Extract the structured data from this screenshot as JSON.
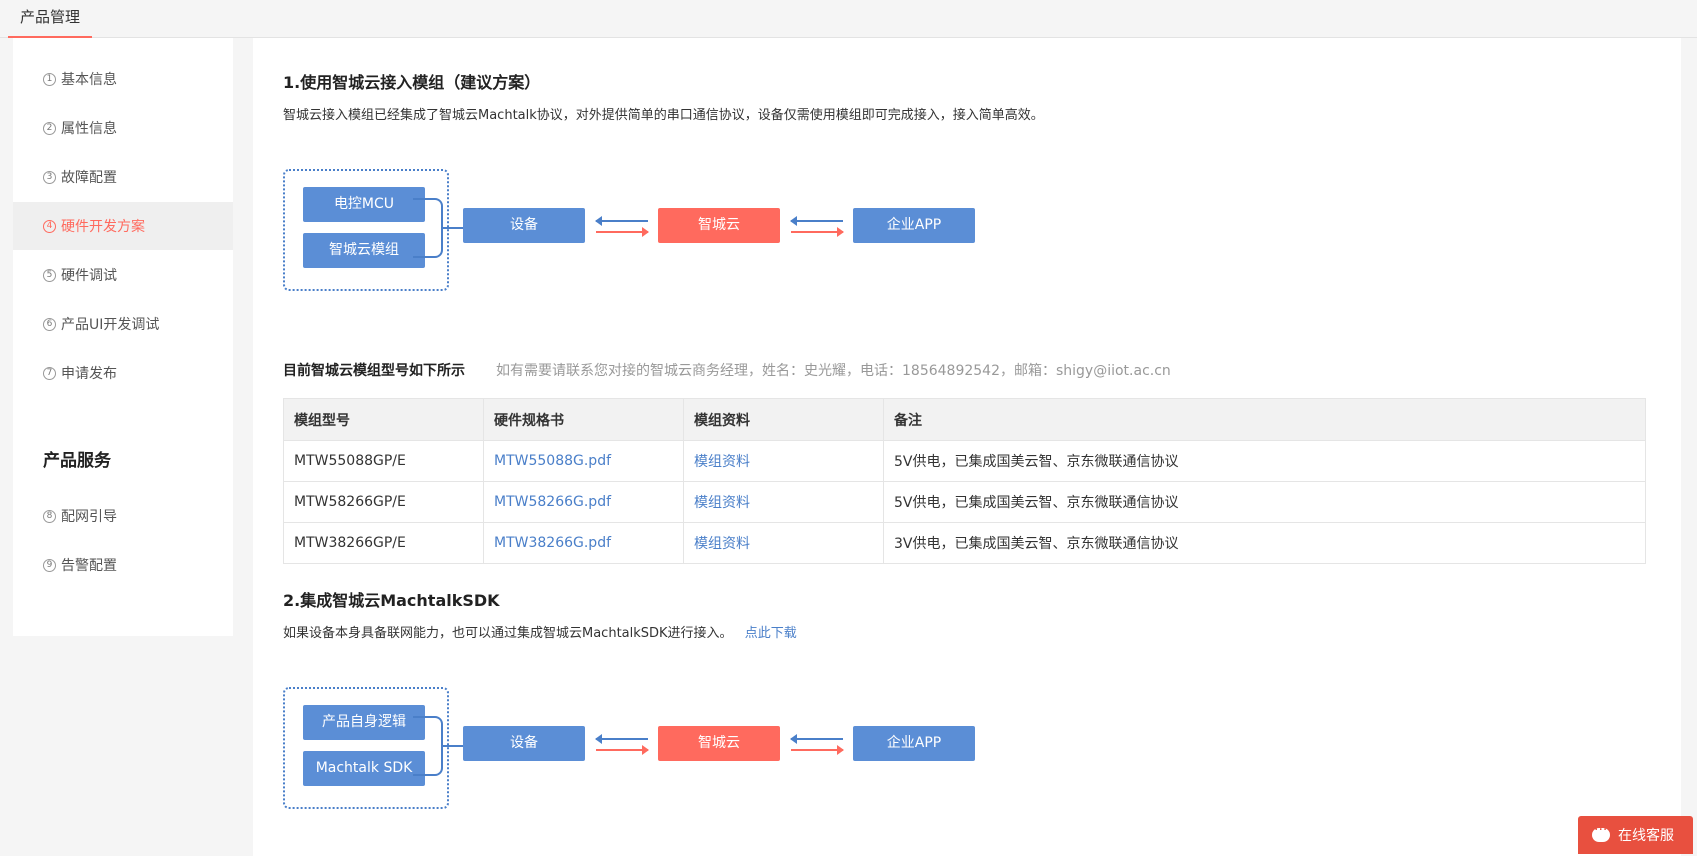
{
  "topbar": {
    "tab_label": "产品管理"
  },
  "sidebar": {
    "items": [
      {
        "num": "1",
        "label": "基本信息"
      },
      {
        "num": "2",
        "label": "属性信息"
      },
      {
        "num": "3",
        "label": "故障配置"
      },
      {
        "num": "4",
        "label": "硬件开发方案"
      },
      {
        "num": "5",
        "label": "硬件调试"
      },
      {
        "num": "6",
        "label": "产品UI开发调试"
      },
      {
        "num": "7",
        "label": "申请发布"
      },
      {
        "num": "8",
        "label": "配网引导"
      },
      {
        "num": "9",
        "label": "告警配置"
      }
    ],
    "section_title": "产品服务",
    "active_index": 3
  },
  "section1": {
    "title": "1.使用智城云接入模组（建议方案）",
    "desc": "智城云接入模组已经集成了智城云Machtalk协议，对外提供简单的串口通信协议，设备仅需使用模组即可完成接入，接入简单高效。",
    "diagram": {
      "group": [
        "电控MCU",
        "智城云模组"
      ],
      "device": "设备",
      "cloud": "智城云",
      "app": "企业APP"
    }
  },
  "module_table": {
    "title": "目前智城云模组型号如下所示",
    "note": "如有需要请联系您对接的智城云商务经理，姓名：史光耀，电话：18564892542，邮箱：shigy@iiot.ac.cn",
    "headers": [
      "模组型号",
      "硬件规格书",
      "模组资料",
      "备注"
    ],
    "rows": [
      [
        "MTW55088GP/E",
        "MTW55088G.pdf",
        "模组资料",
        "5V供电，已集成国美云智、京东微联通信协议"
      ],
      [
        "MTW58266GP/E",
        "MTW58266G.pdf",
        "模组资料",
        "5V供电，已集成国美云智、京东微联通信协议"
      ],
      [
        "MTW38266GP/E",
        "MTW38266G.pdf",
        "模组资料",
        "3V供电，已集成国美云智、京东微联通信协议"
      ]
    ]
  },
  "section2": {
    "title": "2.集成智城云MachtalkSDK",
    "desc": "如果设备本身具备联网能力，也可以通过集成智城云MachtalkSDK进行接入。",
    "download_link": "点此下载",
    "diagram": {
      "group": [
        "产品自身逻辑",
        "Machtalk SDK"
      ],
      "device": "设备",
      "cloud": "智城云",
      "app": "企业APP"
    }
  },
  "chat": {
    "label": "在线客服",
    "icon": "chat-bubble-icon"
  },
  "colors": {
    "accent": "#ff6a5e",
    "blue": "#5b8ed6",
    "link": "#4a7fc9"
  }
}
